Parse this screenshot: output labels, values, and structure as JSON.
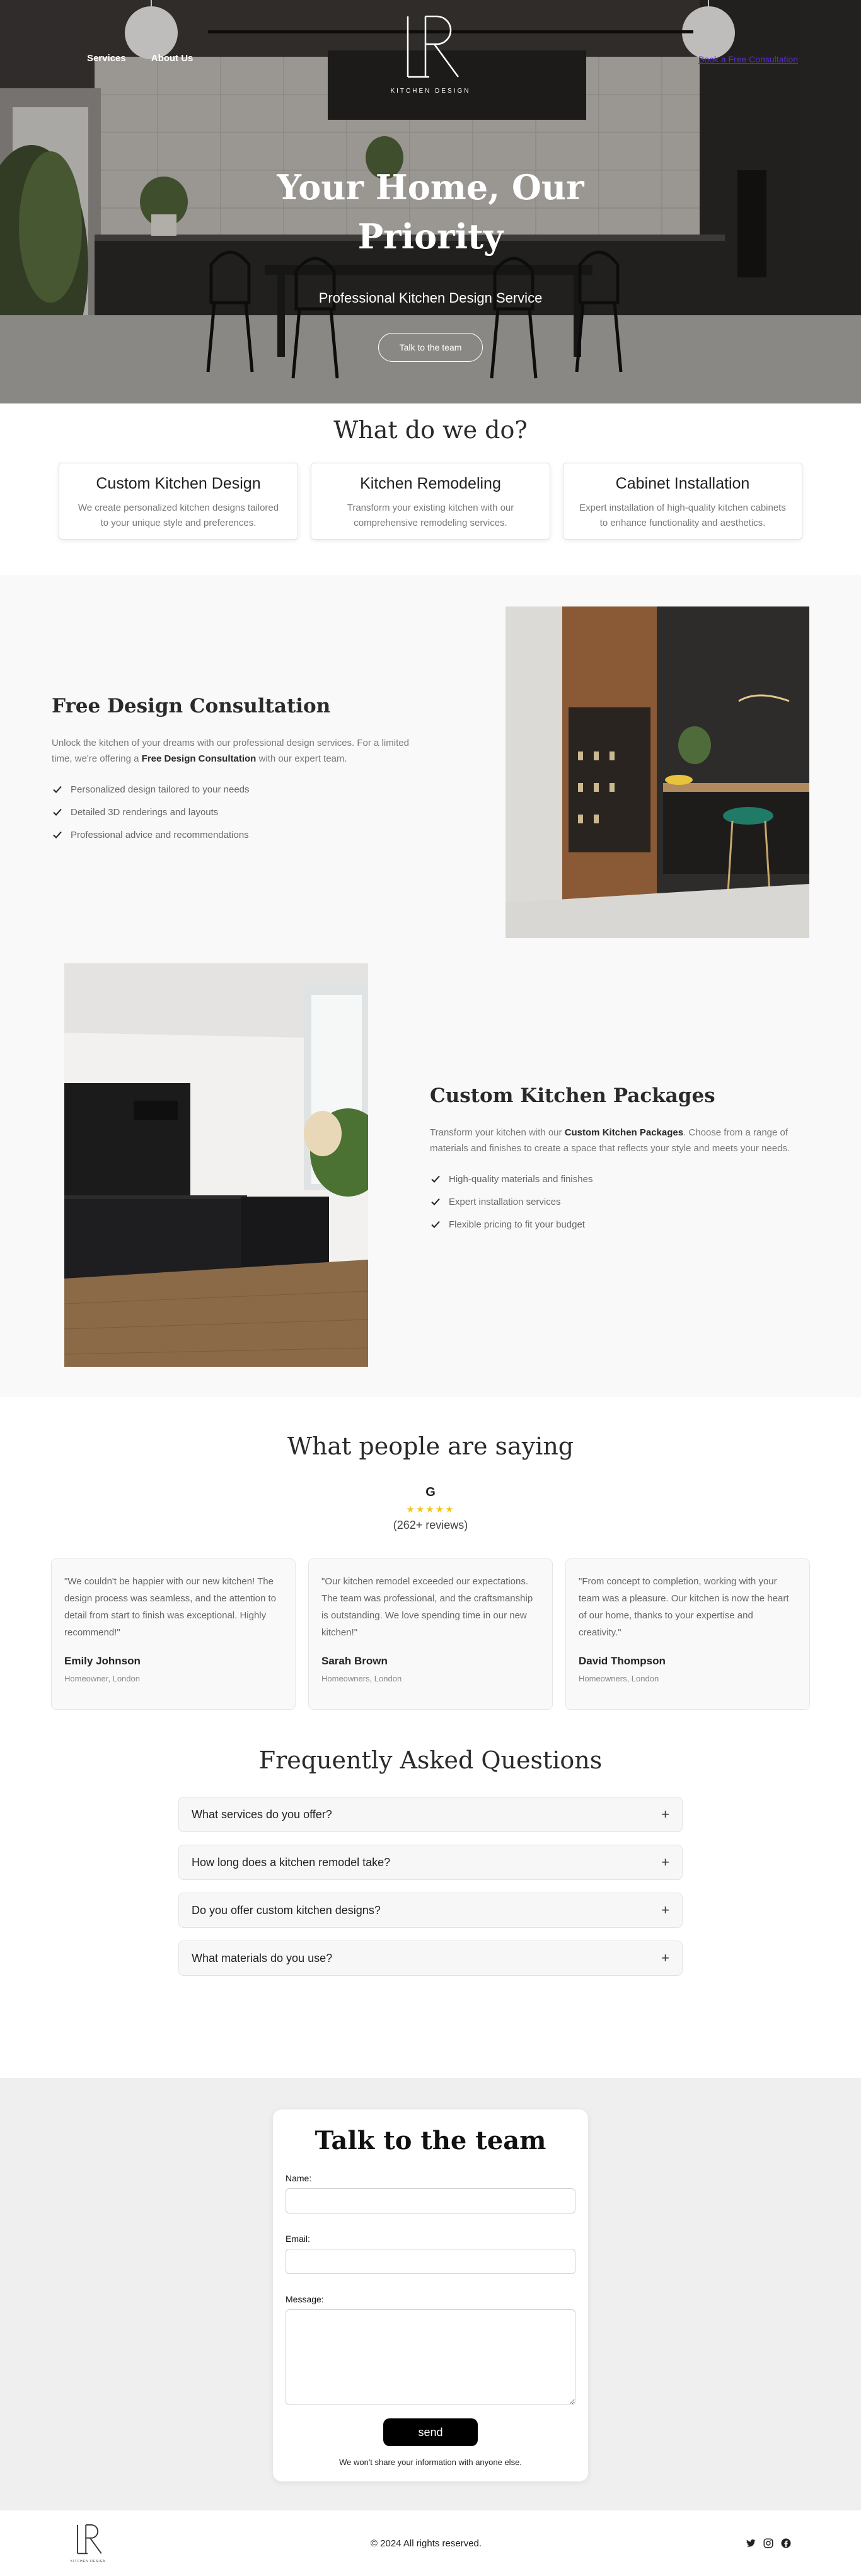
{
  "hero": {
    "nav": [
      "Services",
      "About Us"
    ],
    "logo_letters": "LR",
    "logo_sub": "KITCHEN DESIGN",
    "cta_link": "Book a Free Consultation",
    "title": "Your Home, Our Priority",
    "subtitle": "Professional Kitchen Design Service",
    "button": "Talk to the team"
  },
  "services": {
    "title": "What do we do?",
    "cards": [
      {
        "title": "Custom Kitchen Design",
        "desc": "We create personalized kitchen designs tailored to your unique style and preferences."
      },
      {
        "title": "Kitchen Remodeling",
        "desc": "Transform your existing kitchen with our comprehensive remodeling services."
      },
      {
        "title": "Cabinet Installation",
        "desc": "Expert installation of high-quality kitchen cabinets to enhance functionality and aesthetics."
      }
    ]
  },
  "consultation": {
    "title": "Free Design Consultation",
    "desc_start": "Unlock the kitchen of your dreams with our professional design services. For a limited time, we're offering a ",
    "desc_bold": "Free Design Consultation",
    "desc_end": " with our expert team.",
    "points": [
      "Personalized design tailored to your needs",
      "Detailed 3D renderings and layouts",
      "Professional advice and recommendations"
    ]
  },
  "packages": {
    "title": "Custom Kitchen Packages",
    "desc_start": "Transform your kitchen with our ",
    "desc_bold": "Custom Kitchen Packages",
    "desc_end": ". Choose from a range of materials and finishes to create a space that reflects your style and meets your needs.",
    "points": [
      "High-quality materials and finishes",
      "Expert installation services",
      "Flexible pricing to fit your budget"
    ]
  },
  "testimonials": {
    "title": "What people are saying",
    "google_letter": "G",
    "stars": "★★★★★",
    "reviews": "(262+ reviews)",
    "cards": [
      {
        "quote": "\"We couldn't be happier with our new kitchen! The design process was seamless, and the attention to detail from start to finish was exceptional. Highly recommend!\"",
        "name": "Emily Johnson",
        "role": "Homeowner, London"
      },
      {
        "quote": "\"Our kitchen remodel exceeded our expectations. The team was professional, and the craftsmanship is outstanding. We love spending time in our new kitchen!\"",
        "name": "Sarah Brown",
        "role": "Homeowners, London"
      },
      {
        "quote": "\"From concept to completion, working with your team was a pleasure. Our kitchen is now the heart of our home, thanks to your expertise and creativity.\"",
        "name": "David Thompson",
        "role": "Homeowners, London"
      }
    ]
  },
  "faq": {
    "title": "Frequently Asked Questions",
    "items": [
      "What services do you offer?",
      "How long does a kitchen remodel take?",
      "Do you offer custom kitchen designs?",
      "What materials do you use?"
    ],
    "toggle": "+"
  },
  "contact": {
    "title": "Talk to the team",
    "name_label": "Name:",
    "email_label": "Email:",
    "message_label": "Message:",
    "send": "send",
    "note": "We won't share your information with anyone else."
  },
  "footer": {
    "logo_letters": "LR",
    "logo_sub": "KITCHEN DESIGN",
    "copyright": "© 2024 All rights reserved."
  },
  "colors": {
    "accent_link": "#5a2bd4",
    "star": "#f5c518",
    "button_dark": "#000000"
  },
  "icons": [
    "check-icon",
    "plus-icon",
    "twitter-icon",
    "instagram-icon",
    "facebook-icon",
    "google-icon"
  ]
}
